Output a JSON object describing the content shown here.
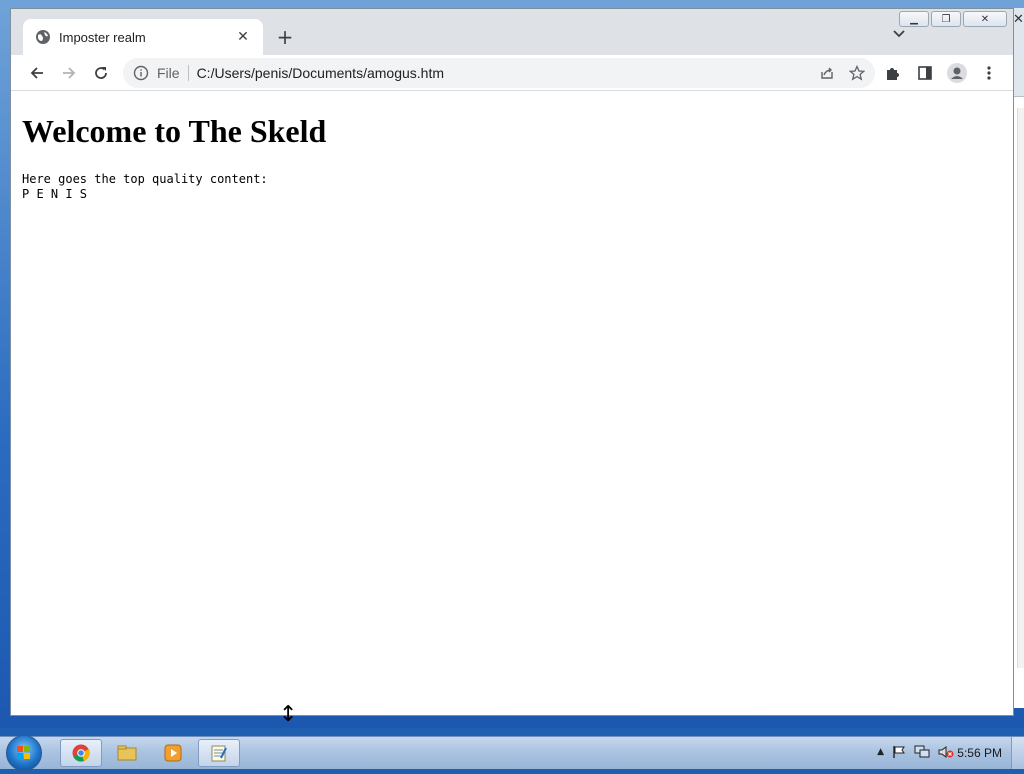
{
  "browser": {
    "tab": {
      "title": "Imposter realm",
      "favicon": "globe-icon",
      "close_icon": "close-icon"
    },
    "new_tab_icon": "plus-icon",
    "tab_search_icon": "chevron-down-icon",
    "window_controls": {
      "minimize": "minimize-icon",
      "restore": "restore-icon",
      "close": "close-icon"
    },
    "toolbar": {
      "back_icon": "back-arrow-icon",
      "forward_icon": "forward-arrow-icon",
      "reload_icon": "reload-icon",
      "site_info_icon": "info-icon",
      "scheme_label": "File",
      "url": "C:/Users/penis/Documents/amogus.htm",
      "share_icon": "share-icon",
      "bookmark_icon": "star-icon",
      "extensions_icon": "puzzle-icon",
      "side_panel_icon": "side-panel-icon",
      "profile_icon": "profile-icon",
      "menu_icon": "kebab-menu-icon"
    }
  },
  "page": {
    "heading": "Welcome to The Skeld",
    "line1": "Here goes the top quality content:",
    "line2": "P E N I S"
  },
  "taskbar": {
    "start_icon": "windows-start-icon",
    "apps": [
      "chrome-icon",
      "file-explorer-icon",
      "media-player-icon",
      "notepad-icon"
    ],
    "tray": [
      "show-hidden-icons-icon",
      "action-center-flag-icon",
      "network-icon",
      "volume-muted-icon"
    ],
    "clock": "5:56 PM"
  },
  "colors": {
    "tabstrip": "#dee1e6",
    "omnibox": "#f1f3f4",
    "taskbar": "#a9c2e0"
  }
}
